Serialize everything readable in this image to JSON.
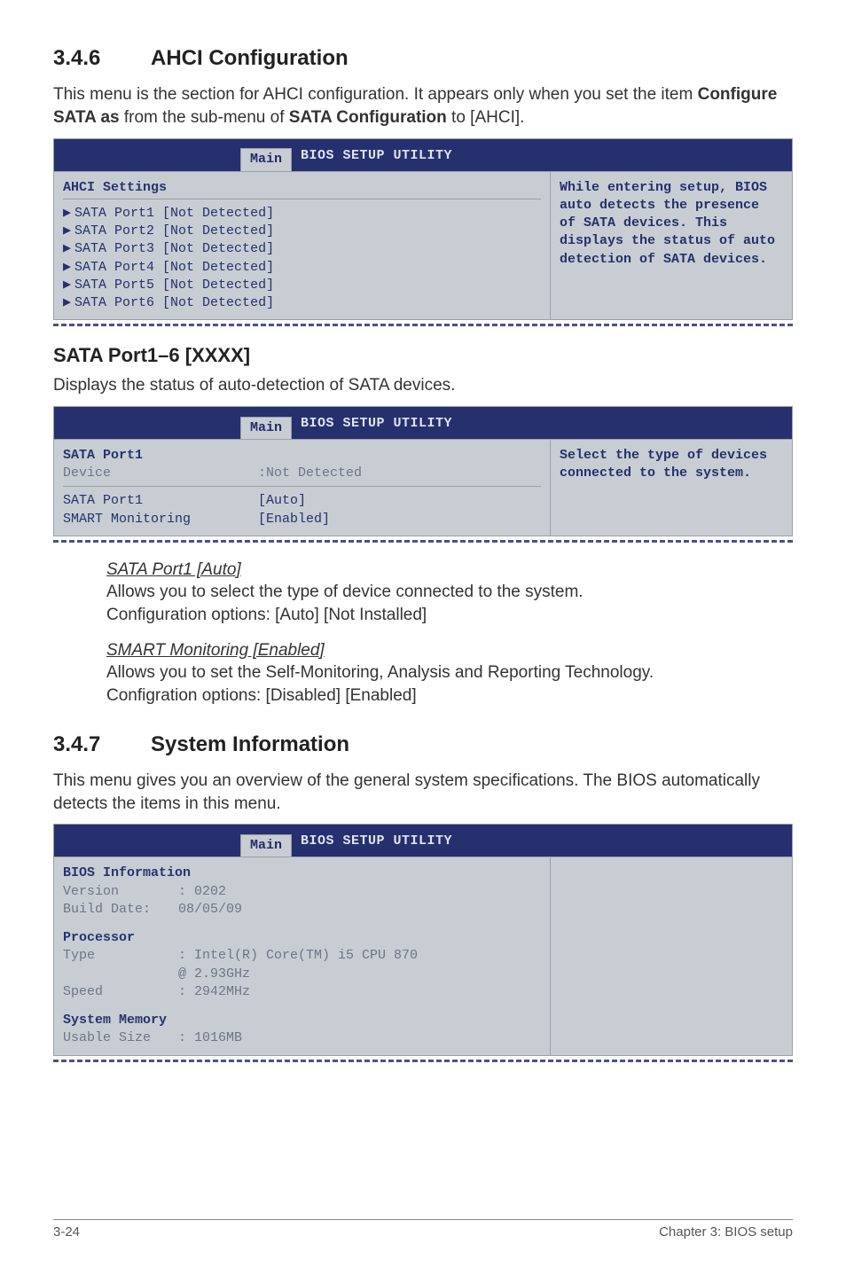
{
  "section346": {
    "num": "3.4.6",
    "title": "AHCI Configuration",
    "intro_a": "This menu is the section for AHCI configuration. It appears only when you set the item ",
    "intro_b": "Configure SATA as",
    "intro_c": " from the sub-menu of ",
    "intro_d": "SATA Configuration",
    "intro_e": " to [AHCI]."
  },
  "bios1": {
    "utility_title": "BIOS SETUP UTILITY",
    "tab": "Main",
    "group": "AHCI Settings",
    "items": [
      "SATA Port1 [Not Detected]",
      "SATA Port2 [Not Detected]",
      "SATA Port3 [Not Detected]",
      "SATA Port4 [Not Detected]",
      "SATA Port5 [Not Detected]",
      "SATA Port6 [Not Detected]"
    ],
    "help": "While entering setup, BIOS auto detects the presence of SATA devices. This displays the status of auto detection of SATA devices."
  },
  "subheadA": "SATA Port1–6 [XXXX]",
  "subintroA": "Displays the status of auto-detection of SATA devices.",
  "bios2": {
    "utility_title": "BIOS SETUP UTILITY",
    "tab": "Main",
    "group": "SATA Port1",
    "device_k": "Device",
    "device_v": ":Not Detected",
    "rows": [
      {
        "k": "SATA Port1",
        "v": "[Auto]"
      },
      {
        "k": "SMART Monitoring",
        "v": "[Enabled]"
      }
    ],
    "help": "Select the type of devices connected to the system."
  },
  "subs": {
    "a_title": "SATA Port1 [Auto]",
    "a_l1": "Allows you to select the type of device connected to the system.",
    "a_l2": "Configuration options: [Auto] [Not Installed]",
    "b_title": "SMART Monitoring [Enabled]",
    "b_l1": "Allows you to set the Self-Monitoring, Analysis and Reporting Technology.",
    "b_l2": "Configration options: [Disabled] [Enabled]"
  },
  "section347": {
    "num": "3.4.7",
    "title": "System Information",
    "intro": "This menu gives you an overview of the general system specifications. The BIOS automatically detects the items in this menu."
  },
  "bios3": {
    "utility_title": "BIOS SETUP UTILITY",
    "tab": "Main",
    "g1": "BIOS Information",
    "g1a_k": "Version",
    "g1a_v": ": 0202",
    "g1b_k": "Build Date:",
    "g1b_v": "08/05/09",
    "g2": "Processor",
    "g2a_k": "Type",
    "g2a_v": ": Intel(R) Core(TM) i5 CPU 870",
    "g2a2_v": "  @ 2.93GHz",
    "g2b_k": "Speed",
    "g2b_v": ": 2942MHz",
    "g3": "System Memory",
    "g3a_k": "Usable Size",
    "g3a_v": ": 1016MB"
  },
  "footer": {
    "left": "3-24",
    "right": "Chapter 3: BIOS setup"
  }
}
